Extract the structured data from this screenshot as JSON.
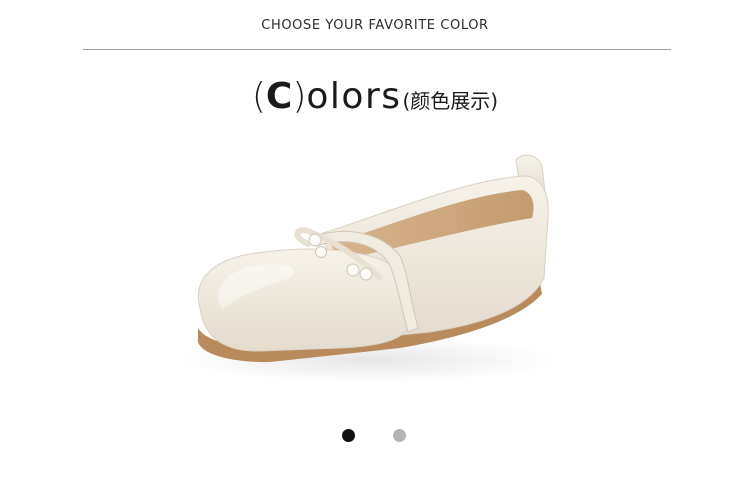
{
  "header": {
    "label": "CHOOSE YOUR FAVORITE COLOR"
  },
  "title": {
    "open_paren": "(",
    "capital": "C",
    "close_paren": ")",
    "rest": "olors",
    "chinese": "(颜色展示)"
  },
  "product_image": {
    "icon": "shoe-image",
    "colors": {
      "upper": "#efe9dd",
      "upper_shadow": "#d9d1c1",
      "lining": "#c9a57e",
      "sole": "#b98a5c"
    }
  },
  "carousel": {
    "active_index": 0,
    "dots": [
      {
        "color": "#111111"
      },
      {
        "color": "#b3b3b3"
      }
    ]
  }
}
